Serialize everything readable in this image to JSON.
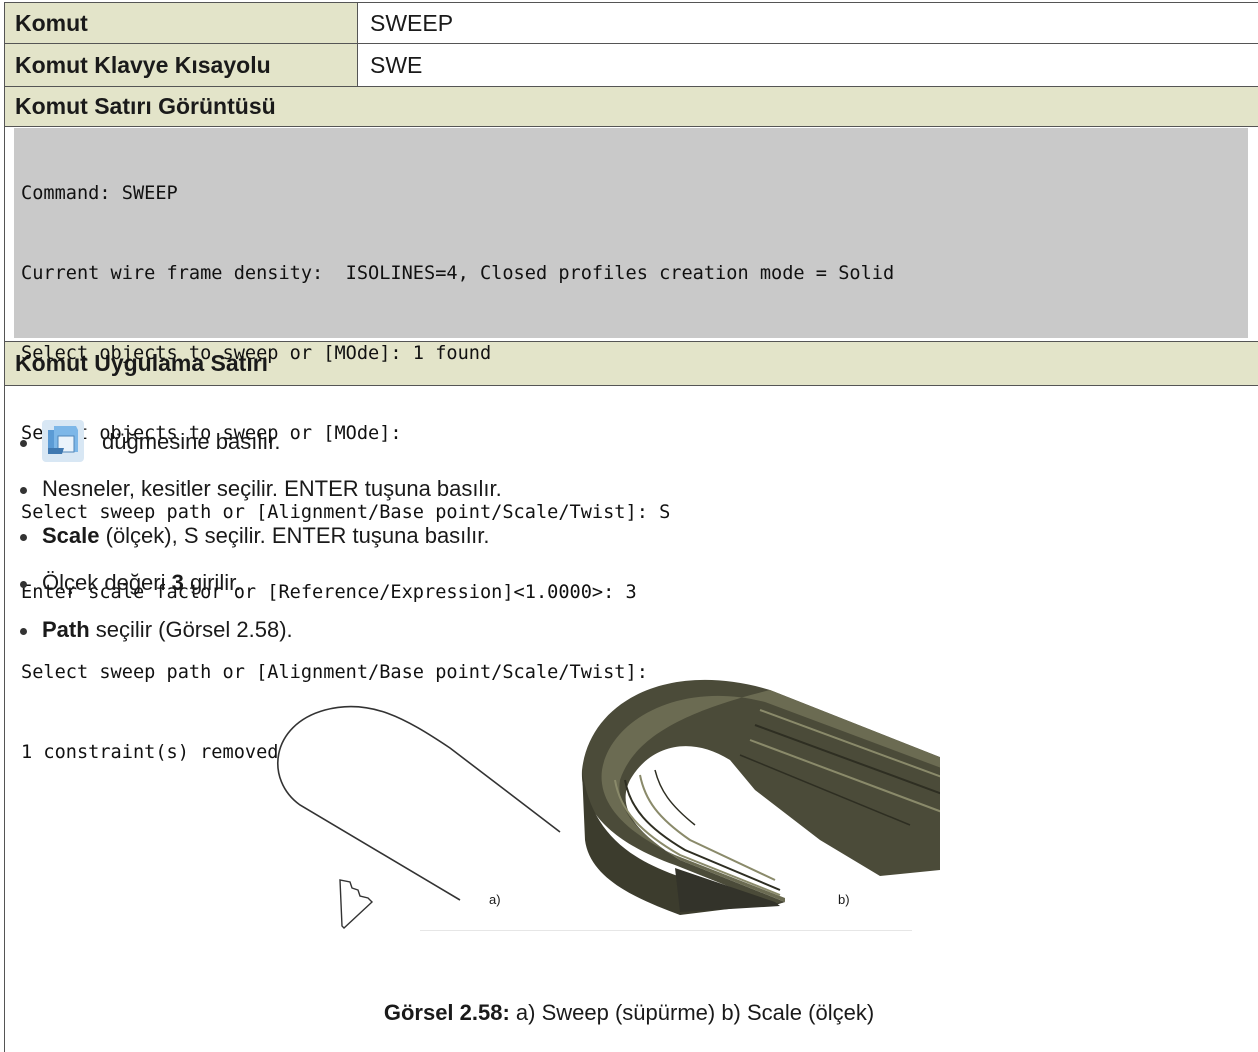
{
  "table": {
    "command_label": "Komut",
    "command_value": "SWEEP",
    "shortcut_label": "Komut Klavye Kısayolu",
    "shortcut_value": "SWE",
    "cmdline_label": "Komut Satırı Görüntüsü",
    "apply_label": "Komut Uygulama Satırı"
  },
  "command_lines": [
    "Command: SWEEP",
    "Current wire frame density:  ISOLINES=4, Closed profiles creation mode = Solid",
    "Select objects to sweep or [MOde]: 1 found",
    "Select objects to sweep or [MOde]:",
    "Select sweep path or [Alignment/Base point/Scale/Twist]: S",
    "Enter scale factor or [Reference/Expression]<1.0000>: 3",
    "Select sweep path or [Alignment/Base point/Scale/Twist]:",
    "1 constraint(s) removed"
  ],
  "steps": {
    "s1_text": "düğmesine basılır.",
    "s2_text": "Nesneler, kesitler seçilir. ENTER tuşuna basılır.",
    "s3_bold": "Scale",
    "s3_text": " (ölçek), S seçilir. ENTER tuşuna basılır.",
    "s4_pre": "Ölçek değeri ",
    "s4_bold": "3",
    "s4_post": " girilir.",
    "s5_bold": "Path",
    "s5_text": " seçilir (Görsel 2.58)."
  },
  "figure": {
    "label_a": "a)",
    "label_b": "b)",
    "caption_bold": "Görsel 2.58:",
    "caption_text": " a) Sweep (süpürme)  b) Scale (ölçek)"
  },
  "icons": [
    "sweep-icon"
  ],
  "colors": {
    "header_bg": "#e3e4c9",
    "cmd_bg": "#c9c9c9",
    "solid": "#4a4a38"
  }
}
